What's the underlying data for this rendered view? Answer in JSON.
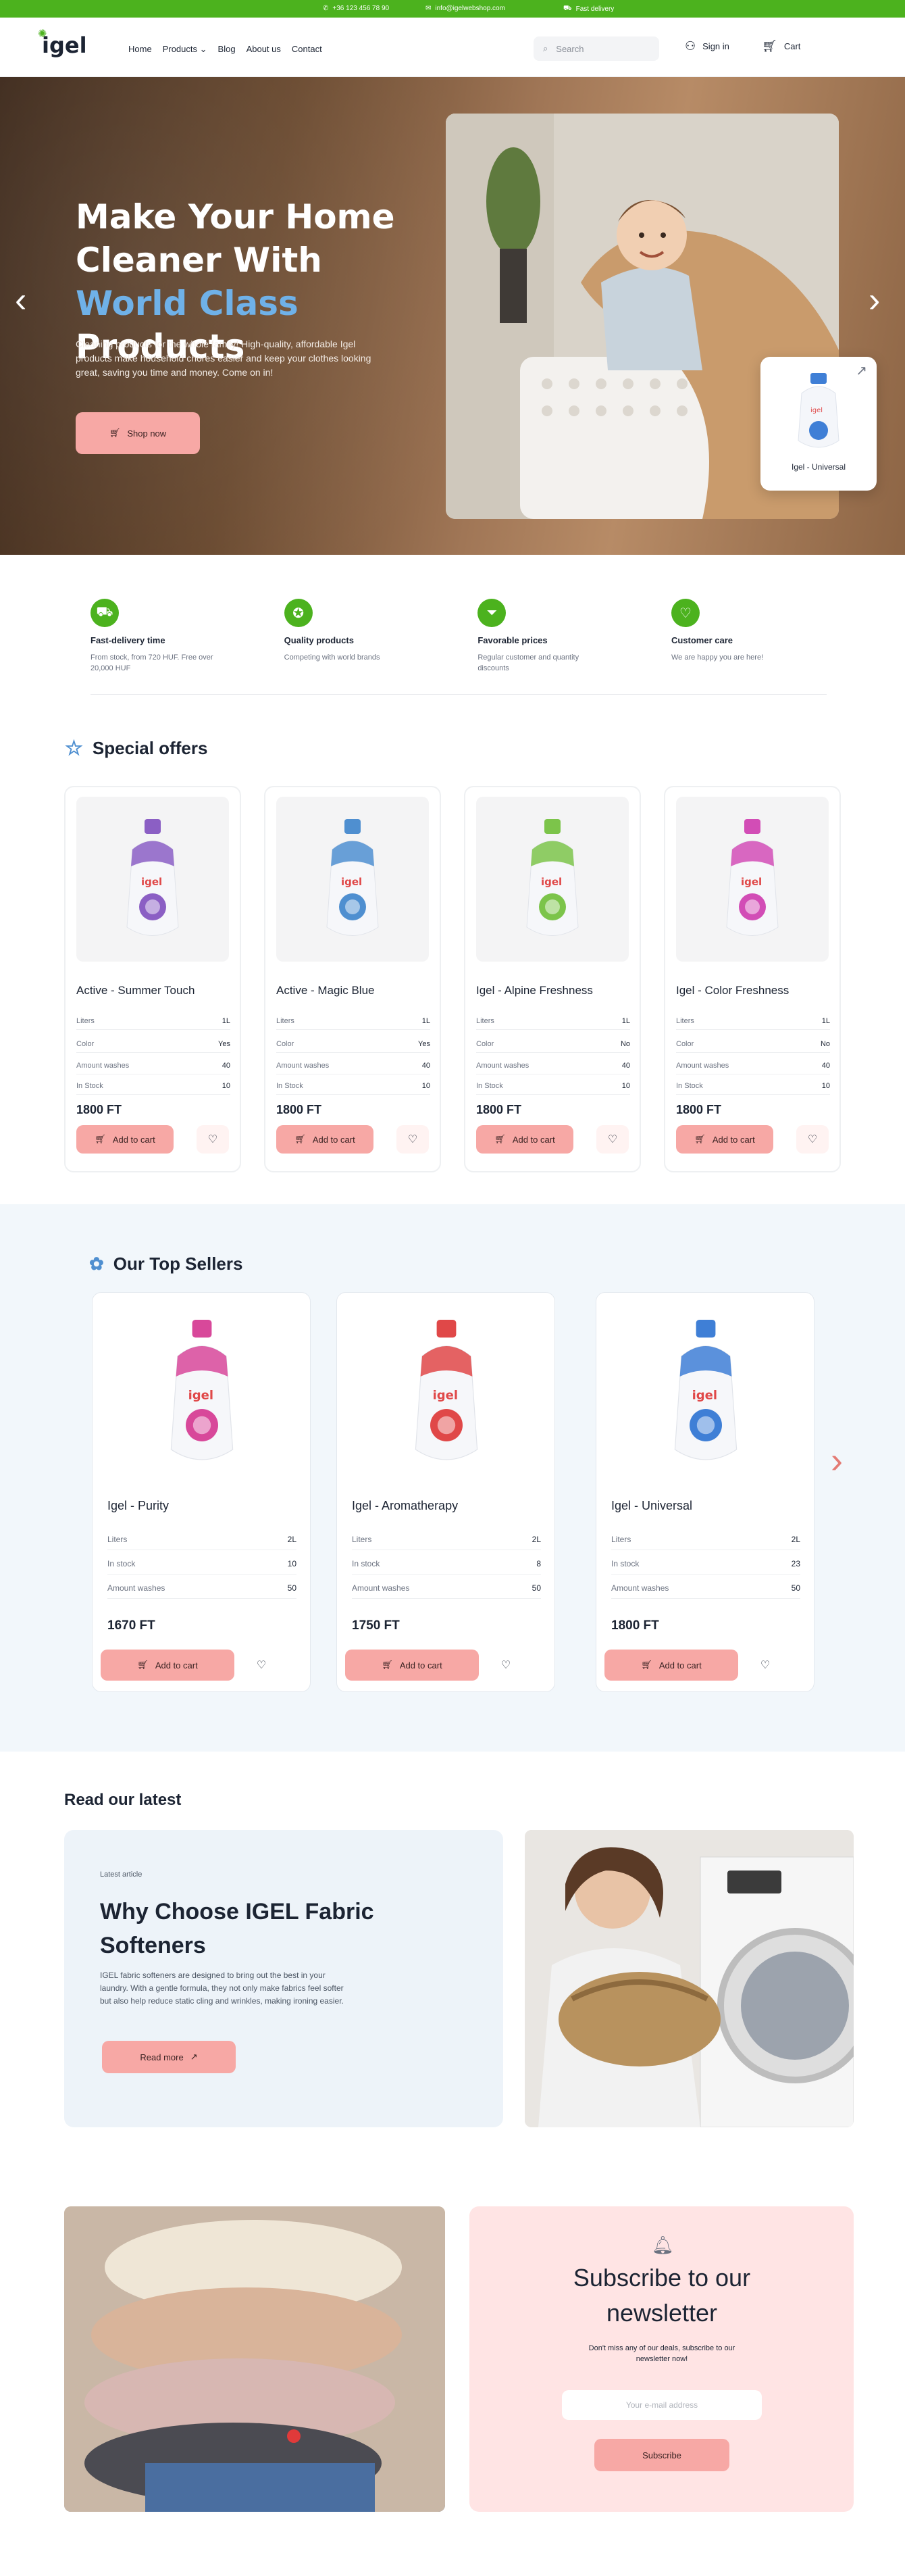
{
  "topbar": {
    "phone": "+36 123 456 78 90",
    "email": "info@igelwebshop.com",
    "delivery": "Fast delivery"
  },
  "header": {
    "logo": "igel",
    "nav": [
      "Home",
      "Products",
      "Blog",
      "About us",
      "Contact"
    ],
    "search_placeholder": "Search",
    "signin": "Sign in",
    "cart": "Cart"
  },
  "hero": {
    "title_part1": "Make Your Home Cleaner With ",
    "title_highlight": "World Class",
    "title_part2": " Products",
    "text": "Cleaning products for the whole family! High-quality, affordable Igel products make household chores easier and keep your clothes looking great, saving you time and money. Come on in!",
    "button": "Shop now",
    "mini_card": "Igel - Universal"
  },
  "features": [
    {
      "title": "Fast-delivery time",
      "text": "From stock, from 720 HUF. Free over 20,000 HUF",
      "icon": "truck-icon"
    },
    {
      "title": "Quality products",
      "text": "Competing with world brands",
      "icon": "award-icon"
    },
    {
      "title": "Favorable prices",
      "text": "Regular customer and quantity discounts",
      "icon": "price-tag-icon"
    },
    {
      "title": "Customer care",
      "text": "We are happy you are here!",
      "icon": "heart-hand-icon"
    }
  ],
  "special_offers": {
    "title": "Special offers",
    "labels": {
      "liters": "Liters",
      "color": "Color",
      "washes": "Amount washes",
      "stock": "In Stock",
      "add": "Add to cart"
    },
    "items": [
      {
        "name": "Active - Summer Touch",
        "liters": "1L",
        "color": "Yes",
        "washes": "40",
        "stock": "10",
        "price": "1800 FT",
        "bottle": "#8b5fc4"
      },
      {
        "name": "Active - Magic Blue",
        "liters": "1L",
        "color": "Yes",
        "washes": "40",
        "stock": "10",
        "price": "1800 FT",
        "bottle": "#4f8fd0"
      },
      {
        "name": "Igel - Alpine Freshness",
        "liters": "1L",
        "color": "No",
        "washes": "40",
        "stock": "10",
        "price": "1800 FT",
        "bottle": "#7cc44a"
      },
      {
        "name": "Igel - Color Freshness",
        "liters": "1L",
        "color": "No",
        "washes": "40",
        "stock": "10",
        "price": "1800 FT",
        "bottle": "#d24db6"
      }
    ]
  },
  "top_sellers": {
    "title": "Our Top Sellers",
    "labels": {
      "liters": "Liters",
      "stock": "In stock",
      "washes": "Amount washes",
      "add": "Add to cart"
    },
    "items": [
      {
        "name": "Igel - Purity",
        "liters": "2L",
        "stock": "10",
        "washes": "50",
        "price": "1670 FT",
        "bottle": "#d8489a"
      },
      {
        "name": "Igel - Aromatherapy",
        "liters": "2L",
        "stock": "8",
        "washes": "50",
        "price": "1750 FT",
        "bottle": "#e04848"
      },
      {
        "name": "Igel - Universal",
        "liters": "2L",
        "stock": "23",
        "washes": "50",
        "price": "1800 FT",
        "bottle": "#3f7fd6"
      }
    ]
  },
  "blog": {
    "section_title": "Read our latest",
    "tag": "Latest article",
    "title": "Why Choose IGEL Fabric Softeners",
    "text": "IGEL fabric softeners are designed to bring out the best in your laundry. With a gentle formula, they not only make fabrics feel softer but also help reduce static cling and wrinkles, making ironing easier.",
    "button": "Read more"
  },
  "newsletter": {
    "title": "Subscribe to our newsletter",
    "text": "Don't miss any of our deals, subscribe to our newsletter now!",
    "placeholder": "Your e-mail address",
    "button": "Subscribe"
  },
  "colors": {
    "green": "#4cb21e",
    "pink": "#f7a8a5",
    "blue_highlight": "#6fb1e8",
    "light_blue_bg": "#f2f7fb"
  }
}
